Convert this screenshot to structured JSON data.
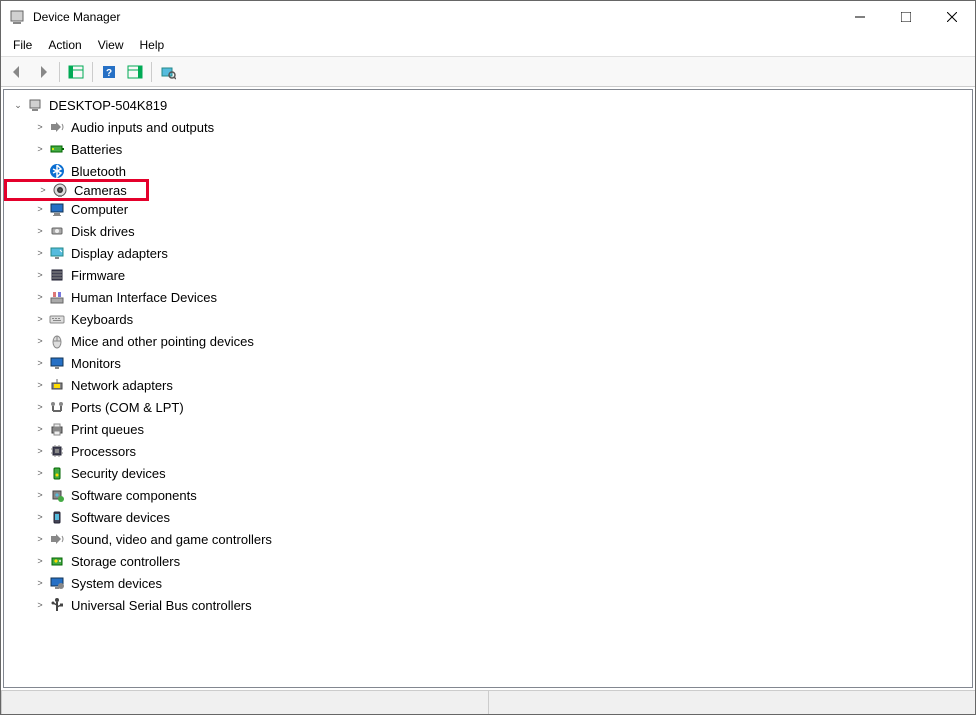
{
  "window": {
    "title": "Device Manager"
  },
  "menu": {
    "file": "File",
    "action": "Action",
    "view": "View",
    "help": "Help"
  },
  "tree": {
    "root": "DESKTOP-504K819",
    "categories": [
      {
        "label": "Audio inputs and outputs",
        "icon": "audio-icon",
        "highlighted": false
      },
      {
        "label": "Batteries",
        "icon": "battery-icon",
        "highlighted": false
      },
      {
        "label": "Bluetooth",
        "icon": "bluetooth-icon",
        "highlighted": false,
        "noExpander": true
      },
      {
        "label": "Cameras",
        "icon": "camera-icon",
        "highlighted": true
      },
      {
        "label": "Computer",
        "icon": "computer-icon",
        "highlighted": false
      },
      {
        "label": "Disk drives",
        "icon": "disk-icon",
        "highlighted": false
      },
      {
        "label": "Display adapters",
        "icon": "display-icon",
        "highlighted": false
      },
      {
        "label": "Firmware",
        "icon": "firmware-icon",
        "highlighted": false
      },
      {
        "label": "Human Interface Devices",
        "icon": "hid-icon",
        "highlighted": false
      },
      {
        "label": "Keyboards",
        "icon": "keyboard-icon",
        "highlighted": false
      },
      {
        "label": "Mice and other pointing devices",
        "icon": "mouse-icon",
        "highlighted": false
      },
      {
        "label": "Monitors",
        "icon": "monitor-icon",
        "highlighted": false
      },
      {
        "label": "Network adapters",
        "icon": "network-icon",
        "highlighted": false
      },
      {
        "label": "Ports (COM & LPT)",
        "icon": "port-icon",
        "highlighted": false
      },
      {
        "label": "Print queues",
        "icon": "printer-icon",
        "highlighted": false
      },
      {
        "label": "Processors",
        "icon": "cpu-icon",
        "highlighted": false
      },
      {
        "label": "Security devices",
        "icon": "security-icon",
        "highlighted": false
      },
      {
        "label": "Software components",
        "icon": "software-comp-icon",
        "highlighted": false
      },
      {
        "label": "Software devices",
        "icon": "software-dev-icon",
        "highlighted": false
      },
      {
        "label": "Sound, video and game controllers",
        "icon": "sound-icon",
        "highlighted": false
      },
      {
        "label": "Storage controllers",
        "icon": "storage-icon",
        "highlighted": false
      },
      {
        "label": "System devices",
        "icon": "system-icon",
        "highlighted": false
      },
      {
        "label": "Universal Serial Bus controllers",
        "icon": "usb-icon",
        "highlighted": false
      }
    ]
  }
}
